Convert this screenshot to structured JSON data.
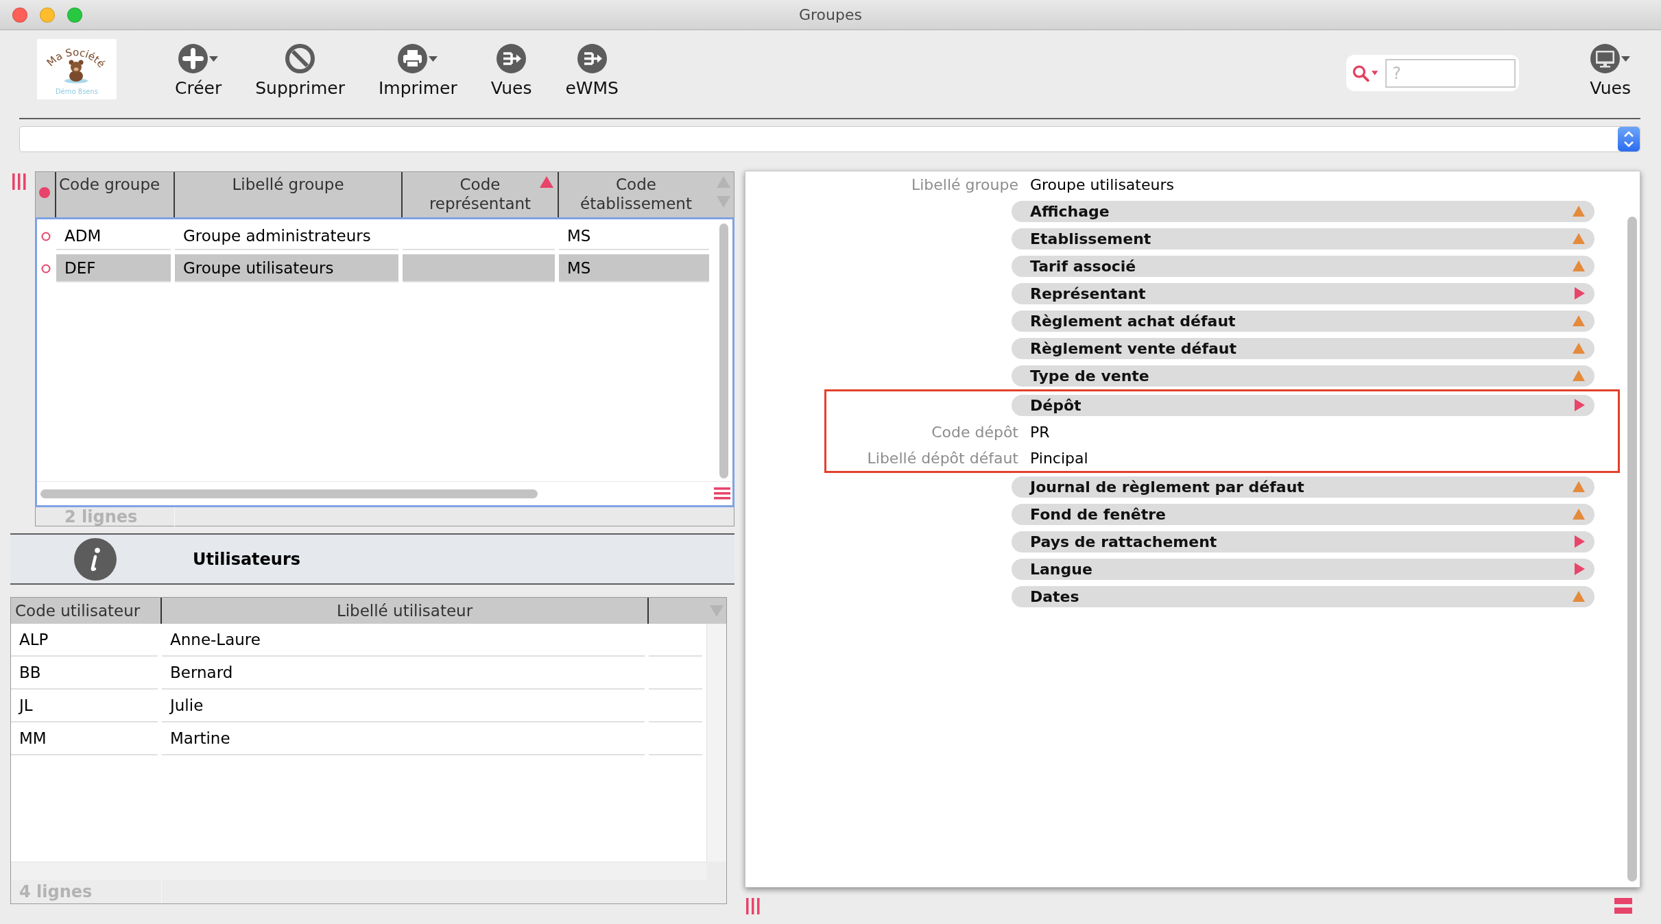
{
  "window": {
    "title": "Groupes"
  },
  "toolbar": {
    "logo": {
      "name": "Ma Société",
      "caption": "Démo 8sens"
    },
    "buttons": [
      {
        "label": "Créer",
        "kind": "create",
        "menu": true
      },
      {
        "label": "Supprimer",
        "kind": "delete",
        "menu": false
      },
      {
        "label": "Imprimer",
        "kind": "print",
        "menu": true
      },
      {
        "label": "Vues",
        "kind": "export",
        "menu": false
      },
      {
        "label": "eWMS",
        "kind": "export",
        "menu": false
      }
    ],
    "search": {
      "placeholder": "?"
    },
    "views_menu": {
      "label": "Vues",
      "menu": true
    }
  },
  "groups_table": {
    "columns": [
      {
        "label": "Code groupe",
        "sorted": false
      },
      {
        "label": "Libellé groupe",
        "sorted": false
      },
      {
        "label": "Code représentant",
        "sorted": true
      },
      {
        "label": "Code établissement",
        "sorted": false
      }
    ],
    "rows": [
      {
        "code": "ADM",
        "label": "Groupe administrateurs",
        "establishment": "MS",
        "selected": false
      },
      {
        "code": "DEF",
        "label": "Groupe utilisateurs",
        "establishment": "MS",
        "selected": true
      }
    ],
    "footer": "2 lignes"
  },
  "users_panel": {
    "title": "Utilisateurs"
  },
  "users_table": {
    "columns": [
      {
        "label": "Code utilisateur"
      },
      {
        "label": "Libellé utilisateur"
      }
    ],
    "rows": [
      {
        "code": "ALP",
        "name": "Anne-Laure"
      },
      {
        "code": "BB",
        "name": "Bernard"
      },
      {
        "code": "JL",
        "name": "Julie"
      },
      {
        "code": "MM",
        "name": "Martine"
      }
    ],
    "footer": "4 lignes"
  },
  "detail": {
    "fields": [
      {
        "label": "Libellé groupe",
        "value": "Groupe utilisateurs"
      }
    ],
    "sections": [
      {
        "title": "Affichage",
        "kind": "up",
        "highlighted": false
      },
      {
        "title": "Etablissement",
        "kind": "up",
        "highlighted": false
      },
      {
        "title": "Tarif associé",
        "kind": "up",
        "highlighted": false
      },
      {
        "title": "Représentant",
        "kind": "right",
        "highlighted": false
      },
      {
        "title": "Règlement achat défaut",
        "kind": "up",
        "highlighted": false
      },
      {
        "title": "Règlement vente défaut",
        "kind": "up",
        "highlighted": false
      },
      {
        "title": "Type de vente",
        "kind": "up",
        "highlighted": false
      },
      {
        "title": "Dépôt",
        "kind": "right",
        "highlighted": true,
        "fields": [
          {
            "label": "Code dépôt",
            "value": "PR"
          },
          {
            "label": "Libellé dépôt défaut",
            "value": "Pincipal"
          }
        ]
      },
      {
        "title": "Journal de règlement par défaut",
        "kind": "up",
        "highlighted": false
      },
      {
        "title": "Fond de fenêtre",
        "kind": "up",
        "highlighted": false
      },
      {
        "title": "Pays de rattachement",
        "kind": "right",
        "highlighted": false
      },
      {
        "title": "Langue",
        "kind": "right",
        "highlighted": false
      },
      {
        "title": "Dates",
        "kind": "up",
        "highlighted": false
      }
    ]
  }
}
